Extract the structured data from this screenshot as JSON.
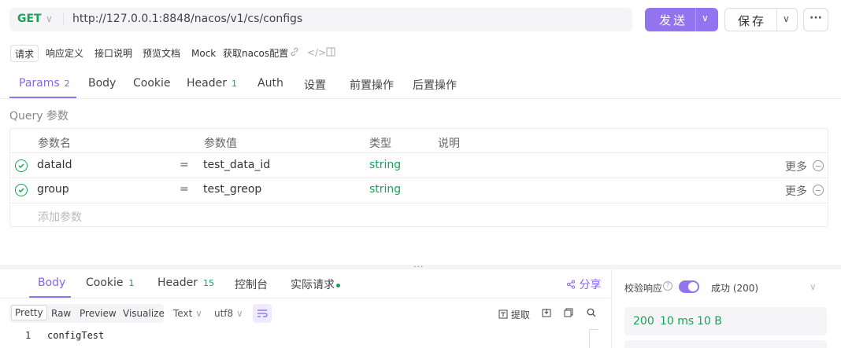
{
  "request": {
    "method": "GET",
    "url": "http://127.0.0.1:8848/nacos/v1/cs/configs",
    "send_label": "发送",
    "save_label": "保存",
    "more_label": "···"
  },
  "subtabs": [
    "请求",
    "响应定义",
    "接口说明",
    "预览文档",
    "Mock",
    "获取nacos配置"
  ],
  "tabs": {
    "params": {
      "label": "Params",
      "count": "2"
    },
    "body": "Body",
    "cookie": "Cookie",
    "header": {
      "label": "Header",
      "count": "1"
    },
    "auth": "Auth",
    "settings": "设置",
    "pre": "前置操作",
    "post": "后置操作"
  },
  "query": {
    "label": "Query 参数",
    "headers": {
      "name": "参数名",
      "value": "参数值",
      "type": "类型",
      "desc": "说明"
    },
    "rows": [
      {
        "name": "dataId",
        "eq": "=",
        "value": "test_data_id",
        "type": "string",
        "more": "更多"
      },
      {
        "name": "group",
        "eq": "=",
        "value": "test_greop",
        "type": "string",
        "more": "更多"
      }
    ],
    "add_placeholder": "添加参数"
  },
  "response": {
    "tabs": {
      "body": "Body",
      "cookie": {
        "label": "Cookie",
        "count": "1"
      },
      "header": {
        "label": "Header",
        "count": "15"
      },
      "console": "控制台",
      "actual": "实际请求"
    },
    "share": "分享",
    "formats": [
      "Pretty",
      "Raw",
      "Preview",
      "Visualize"
    ],
    "text_select": "Text",
    "encoding_select": "utf8",
    "extract": "提取",
    "code": {
      "line": "1",
      "text": "configTest"
    },
    "verify_label": "校验响应",
    "verify_result": "成功 (200)",
    "status": "200",
    "time": "10 ms",
    "size": "10 B"
  },
  "colors": {
    "accent": "#9373ee",
    "success": "#18a058"
  }
}
